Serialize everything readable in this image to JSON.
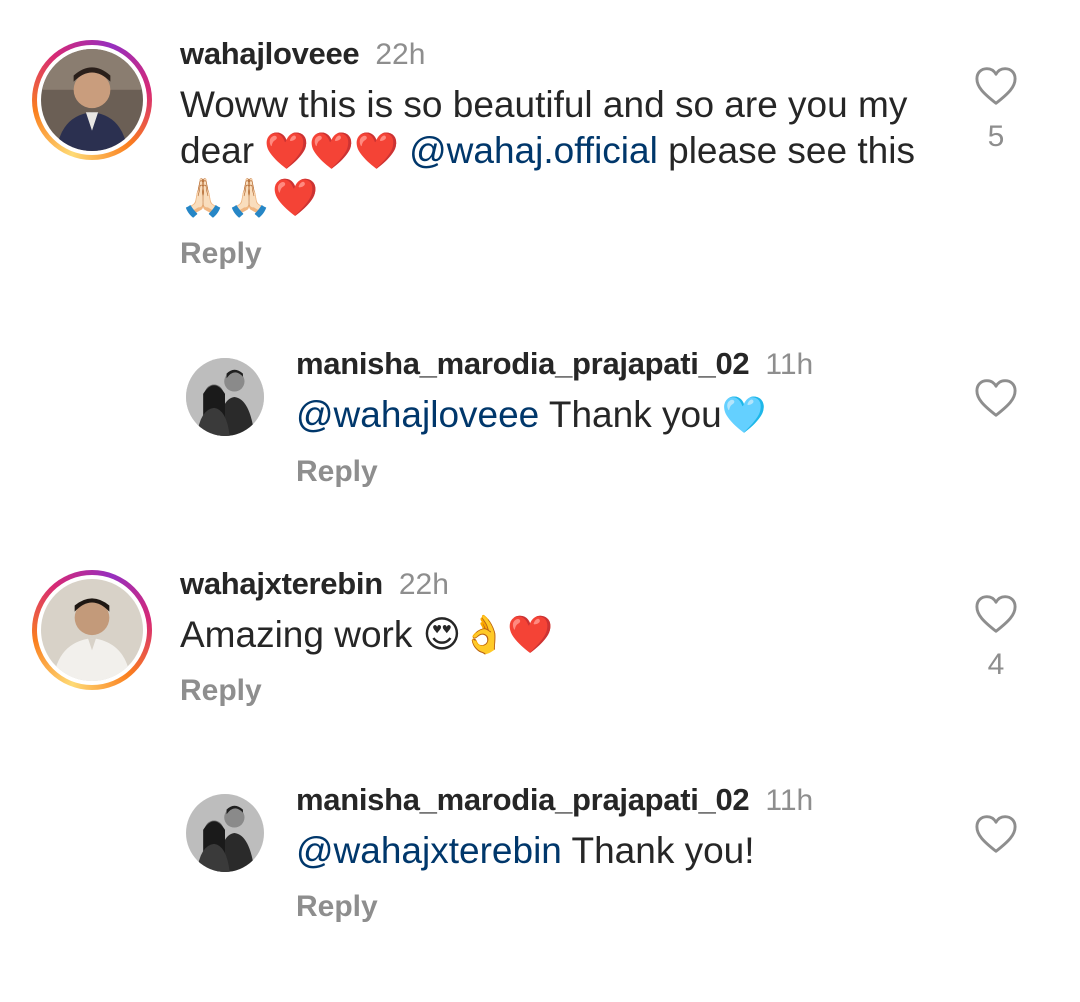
{
  "comments": [
    {
      "username": "wahajloveee",
      "time": "22h",
      "text_before": "Woww this is so beautiful and so are you my dear ",
      "emoji1": "❤️❤️❤️",
      "mention": "@wahaj.official",
      "text_after": " please see this ",
      "emoji2": "🙏🏻🙏🏻❤️",
      "reply": "Reply",
      "likes": "5",
      "icon": "heart-outline-icon"
    },
    {
      "username": "manisha_marodia_prajapati_02",
      "time": "11h",
      "mention": "@wahajloveee",
      "text": " Thank you",
      "emoji": "🩵",
      "reply": "Reply",
      "icon": "heart-outline-icon"
    },
    {
      "username": "wahajxterebin",
      "time": "22h",
      "text": "Amazing work ",
      "emoji": "😍👌❤️",
      "reply": "Reply",
      "likes": "4",
      "icon": "heart-outline-icon"
    },
    {
      "username": "manisha_marodia_prajapati_02",
      "time": "11h",
      "mention": "@wahajxterebin",
      "text": " Thank you!",
      "reply": "Reply",
      "icon": "heart-outline-icon"
    }
  ],
  "colors": {
    "mention": "#00376b",
    "secondary": "#8e8e8e",
    "text": "#262626"
  }
}
